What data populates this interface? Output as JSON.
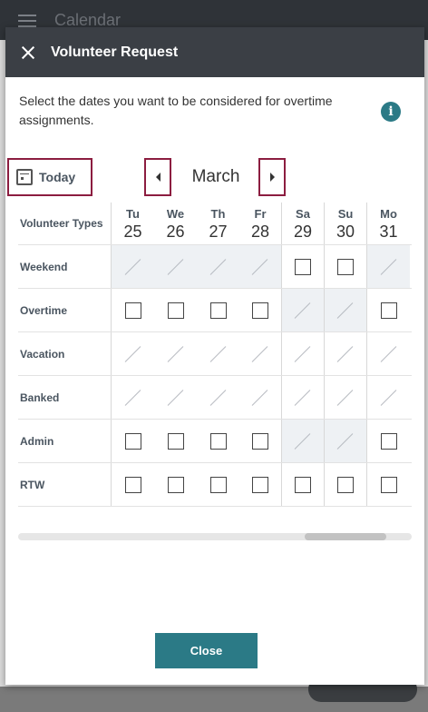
{
  "app": {
    "title": "Calendar"
  },
  "modal": {
    "title": "Volunteer Request",
    "instructions": "Select the dates you want to be considered for overtime assignments.",
    "info_icon": "i",
    "today_label": "Today",
    "month": "March",
    "close_label": "Close"
  },
  "grid": {
    "header_label": "Volunteer Types",
    "days": [
      {
        "dow": "Tu",
        "num": "25"
      },
      {
        "dow": "We",
        "num": "26"
      },
      {
        "dow": "Th",
        "num": "27"
      },
      {
        "dow": "Fr",
        "num": "28"
      },
      {
        "dow": "Sa",
        "num": "29"
      },
      {
        "dow": "Su",
        "num": "30"
      },
      {
        "dow": "Mo",
        "num": "31"
      }
    ],
    "rows": [
      {
        "label": "Weekend",
        "cells": [
          "x",
          "x",
          "x",
          "x",
          "c",
          "c",
          "x"
        ]
      },
      {
        "label": "Overtime",
        "cells": [
          "c",
          "c",
          "c",
          "c",
          "x",
          "x",
          "c"
        ]
      },
      {
        "label": "Vacation",
        "cells": [
          "x",
          "x",
          "x",
          "x",
          "x",
          "x",
          "x"
        ]
      },
      {
        "label": "Banked",
        "cells": [
          "x",
          "x",
          "x",
          "x",
          "x",
          "x",
          "x"
        ]
      },
      {
        "label": "Admin",
        "cells": [
          "c",
          "c",
          "c",
          "c",
          "x",
          "x",
          "c"
        ]
      },
      {
        "label": "RTW",
        "cells": [
          "c",
          "c",
          "c",
          "c",
          "c",
          "c",
          "c"
        ]
      }
    ]
  },
  "colors": {
    "accent": "#2b7a86",
    "focus_border": "#8c1d40",
    "header_bg": "#3b3f45"
  }
}
